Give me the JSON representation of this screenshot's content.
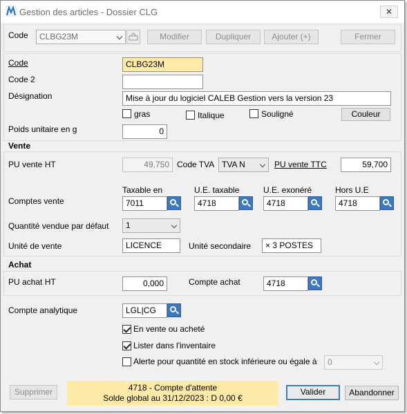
{
  "window": {
    "title": "Gestion des articles - Dossier CLG",
    "close_glyph": "✕"
  },
  "toolbar": {
    "code_label": "Code",
    "code_value": "CLBG23M",
    "modifier": "Modifier",
    "dupliquer": "Dupliquer",
    "ajouter": "Ajouter (+)",
    "fermer": "Fermer"
  },
  "article": {
    "code_label": "Code",
    "code_value": "CLBG23M",
    "code2_label": "Code 2",
    "code2_value": "",
    "designation_label": "Désignation",
    "designation_value": "Mise à jour du logiciel CALEB Gestion vers la version 23",
    "gras": "gras",
    "italique": "Italique",
    "souligne": "Souligné",
    "couleur": "Couleur",
    "poids_label": "Poids unitaire en g",
    "poids_value": "0"
  },
  "vente": {
    "section": "Vente",
    "pu_ht_label": "PU vente HT",
    "pu_ht_value": "49,750",
    "code_tva_label": "Code TVA",
    "code_tva_value": "TVA N",
    "pu_ttc_label": "PU vente TTC",
    "pu_ttc_value": "59,700",
    "comptes_label": "Comptes vente",
    "taxable_label": "Taxable en",
    "taxable_value": "7011",
    "ue_taxable_label": "U.E. taxable",
    "ue_taxable_value": "4718",
    "ue_exonere_label": "U.E. exonéré",
    "ue_exonere_value": "4718",
    "hors_ue_label": "Hors U.E",
    "hors_ue_value": "4718",
    "qte_label": "Quantité vendue par défaut",
    "qte_value": "1",
    "unite_label": "Unité de vente",
    "unite_value": "LICENCE",
    "unite2_label": "Unité secondaire",
    "unite2_value": "× 3 POSTES"
  },
  "achat": {
    "section": "Achat",
    "pu_label": "PU achat HT",
    "pu_value": "0,000",
    "compte_label": "Compte achat",
    "compte_value": "4718"
  },
  "analytique": {
    "label": "Compte analytique",
    "value": "LGL|CG",
    "en_vente": "En vente ou acheté",
    "inventaire": "Lister dans l'inventaire",
    "alerte": "Alerte pour quantité en stock inférieure ou égale à",
    "alerte_value": "0"
  },
  "footer": {
    "supprimer": "Supprimer",
    "status_line1": "4718 - Compte d'attente",
    "status_line2": "Solde global au 31/12/2023 : D 0,00 €",
    "valider": "Valider",
    "abandonner": "Abandonner"
  },
  "colors": {
    "required_field": "#ffeaa8",
    "status_bg": "#fdeaa7",
    "lookup_blue": "#3a78c2",
    "default_button_border": "#3c7fb1"
  }
}
